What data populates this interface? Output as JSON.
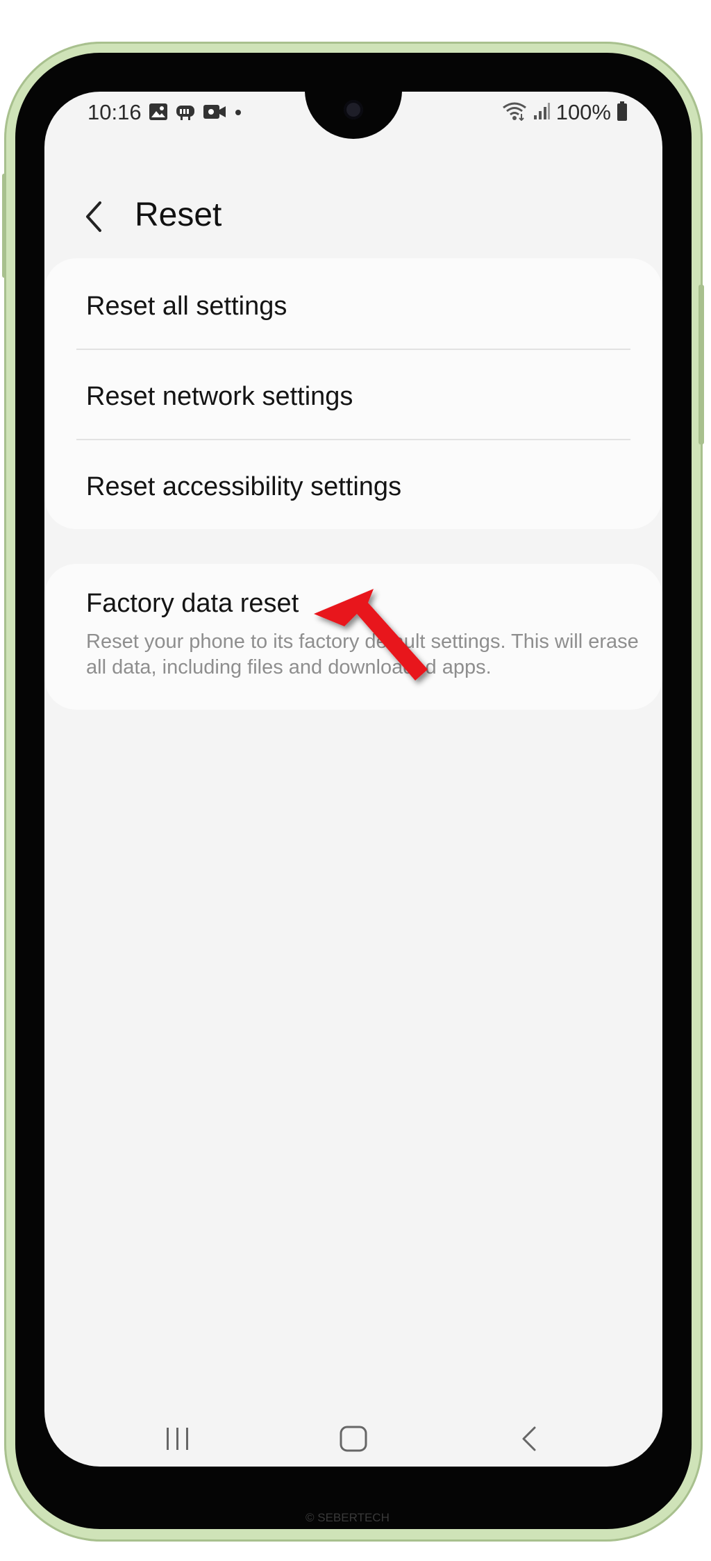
{
  "status_bar": {
    "time": "10:16",
    "left_icons": [
      "gallery-icon",
      "game-controller-icon",
      "video-camera-icon",
      "notification-dot-icon"
    ],
    "right_icons": [
      "wifi-icon",
      "signal-icon",
      "battery-icon"
    ],
    "battery": "100%"
  },
  "header": {
    "title": "Reset",
    "back_icon": "chevron-left-icon"
  },
  "settings": {
    "group_1": [
      {
        "label": "Reset all settings"
      },
      {
        "label": "Reset network settings"
      },
      {
        "label": "Reset accessibility settings"
      }
    ],
    "factory_reset": {
      "label": "Factory data reset",
      "description": "Reset your phone to its factory default settings. This will erase all data, including files and downloaded apps."
    }
  },
  "annotation": {
    "arrow_color": "#e8141b",
    "arrow_icon": "red-pointer-arrow"
  },
  "nav_bar": {
    "icons": [
      "recent-apps-icon",
      "home-icon",
      "back-icon"
    ]
  },
  "watermark": "© SEBERTECH",
  "colors": {
    "frame": "#cfe3b8",
    "screen_bg": "#f4f4f4",
    "card_bg": "#fbfbfb",
    "secondary_text": "#8e8e8e"
  }
}
